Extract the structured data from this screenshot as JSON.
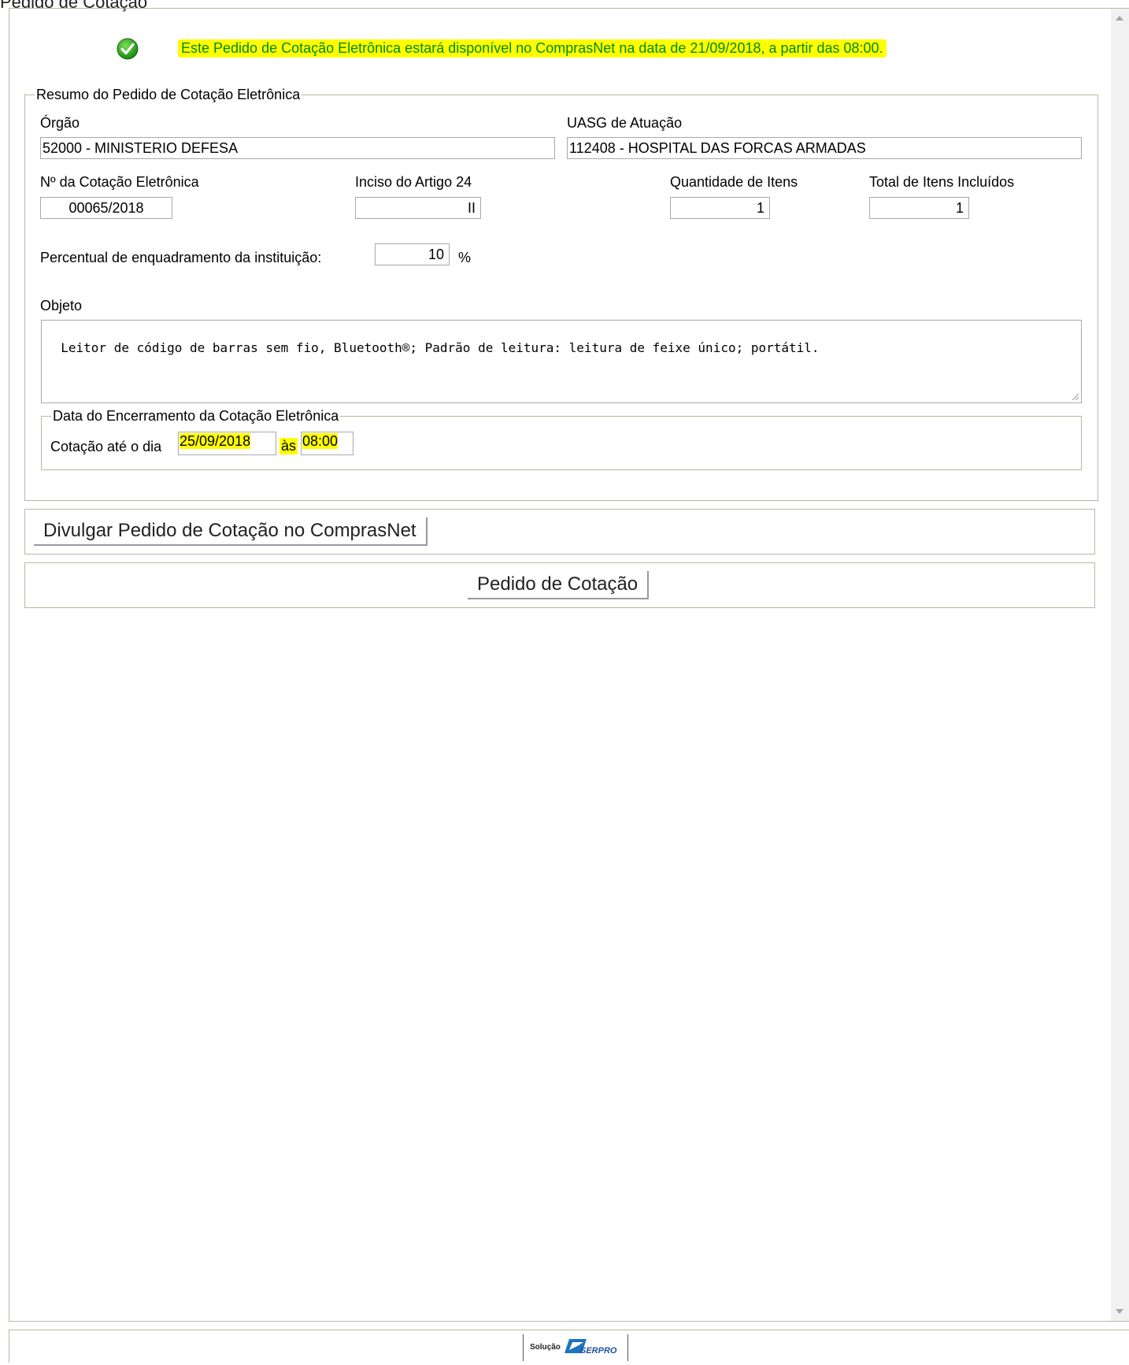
{
  "page": {
    "title": "Pedido de Cotação"
  },
  "notice": {
    "text": "Este Pedido de Cotação Eletrônica estará disponível no ComprasNet na data de 21/09/2018, a partir das 08:00."
  },
  "resumo": {
    "legend": "Resumo do Pedido de Cotação Eletrônica",
    "orgao": {
      "label": "Órgão",
      "value": "52000 - MINISTERIO DEFESA"
    },
    "uasg": {
      "label": "UASG de Atuação",
      "value": "112408 - HOSPITAL DAS FORCAS ARMADAS"
    },
    "cotacao_numero": {
      "label": "Nº da Cotação Eletrônica",
      "value": "00065/2018"
    },
    "inciso": {
      "label": "Inciso do Artigo 24",
      "value": "II"
    },
    "quantidade_itens": {
      "label": "Quantidade de Itens",
      "value": "1"
    },
    "total_itens": {
      "label": "Total de Itens Incluídos",
      "value": "1"
    },
    "percentual": {
      "label": "Percentual de enquadramento da instituição:",
      "value": "10",
      "unit": "%"
    },
    "objeto": {
      "label": "Objeto",
      "value": "Leitor de código de barras sem fio, Bluetooth®; Padrão de leitura: leitura de feixe único; portátil."
    },
    "encerramento": {
      "legend": "Data do Encerramento da Cotação Eletrônica",
      "prefix": "Cotação até o dia",
      "date": "25/09/2018",
      "sep": "às",
      "time": "08:00"
    }
  },
  "actions": {
    "divulgar_label": "Divulgar Pedido de Cotação no ComprasNet",
    "pedido_label": "Pedido de Cotação"
  },
  "footer": {
    "logo_small": "Solução",
    "logo_brand": "SERPRO"
  },
  "colors": {
    "highlight": "#ffff00",
    "notice_text": "#008a00",
    "border": "#b9b9a0"
  }
}
